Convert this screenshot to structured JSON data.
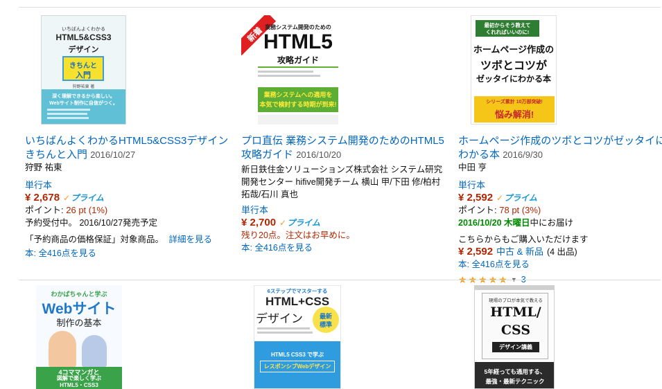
{
  "books": [
    {
      "title": "いちばんよくわかるHTML5&CSS3デザインきちんと入門",
      "date": "2016/10/27",
      "author": "狩野 祐東",
      "format": "単行本",
      "price": "¥ 2,678",
      "prime": "プライム",
      "points_label": "ポイント:",
      "points_value": "26 pt (1%)",
      "preorder": "予約受付中。 2016/10/27発売予定",
      "guarantee": "「予約商品の価格保証」対象商品。",
      "details_link": "詳細を見る",
      "see_all_label": "本:",
      "see_all_link": "全416点を見る",
      "cover": {
        "line1": "いちばんよくわかる",
        "line2": "HTML5&CSS3",
        "line3": "デザイン",
        "badge_top": "きちんと",
        "badge_bottom": "入門",
        "author": "狩野祐東 著",
        "tagline1": "深く理解できるから楽しい。",
        "tagline2": "Webサイト制作に自信がつく。"
      }
    },
    {
      "title": "プロ直伝 業務システム開発のためのHTML5攻略ガイド",
      "date": "2016/10/20",
      "author": "新日鉄住金ソリューションズ株式会社 システム研究開発センター hifive開発チーム 横山 甲/下田 修/柏村 拓哉/石川 真也",
      "format": "単行本",
      "price": "¥ 2,700",
      "prime": "プライム",
      "stock": "残り20点。注文はお早めに。",
      "see_all_label": "本:",
      "see_all_link": "全416点を見る",
      "cover": {
        "new_badge": "新着",
        "line1": "業務システム開発のための",
        "line2": "HTML5",
        "line3": "攻略ガイド",
        "green_line1": "業務システムへの適用を",
        "green_line2": "本気で検討する時期が到来!"
      }
    },
    {
      "title": "ホームページ作成のツボとコツがゼッタイにわかる本",
      "date": "2016/9/30",
      "author": "中田 亨",
      "format": "単行本",
      "price": "¥ 2,592",
      "prime": "プライム",
      "points_label": "ポイント:",
      "points_value": "78 pt (3%)",
      "delivery_date": "2016/10/20 木曜日",
      "delivery_suffix": "中にお届け",
      "other_offers": "こちらからもご購入いただけます",
      "used_price": "¥ 2,592",
      "used_link": "中古 & 新品",
      "used_count": "(4 出品)",
      "see_all_label": "本:",
      "see_all_link": "全416点を見る",
      "rating_stars": 5,
      "review_count": "3",
      "cover": {
        "top_line1": "最初からそう教えて",
        "top_line2": "くれればいいのに!",
        "title1": "ホームページ作成の",
        "title2": "ツボとコツが",
        "title3": "ゼッタイにわかる本",
        "band1": "シリーズ累計 10万部突破!",
        "band2": "悩み解消!"
      }
    }
  ],
  "row2_covers": [
    {
      "line1": "わかばちゃんと学ぶ",
      "line2": "Webサイト",
      "line3": "制作の基本",
      "bottom1": "4コママンガと",
      "bottom2": "図解で楽しく学ぶ",
      "bottom3": "HTML5・CSS3"
    },
    {
      "line0": "6ステップでマスターする",
      "line1": "HTML+CSS",
      "line2": "デザイン",
      "badge1": "最新",
      "badge2": "標準",
      "blue1": "HTML5 CSS3 で学ぶ",
      "blue2": "レスポンシブWebデザイン"
    },
    {
      "line0": "現場のプロが本気で教える",
      "line1": "HTML/",
      "line2": "CSS",
      "line3": "デザイン講義",
      "bottom1": "5年経っても通用する、",
      "bottom2": "最強・最新テクニック"
    }
  ],
  "colors": {
    "link": "#0066c0",
    "price": "#b12704",
    "prime_blue": "#1a98d5",
    "prime_check": "#f79c1e",
    "delivery_green": "#008a00",
    "star": "#f0a020"
  }
}
